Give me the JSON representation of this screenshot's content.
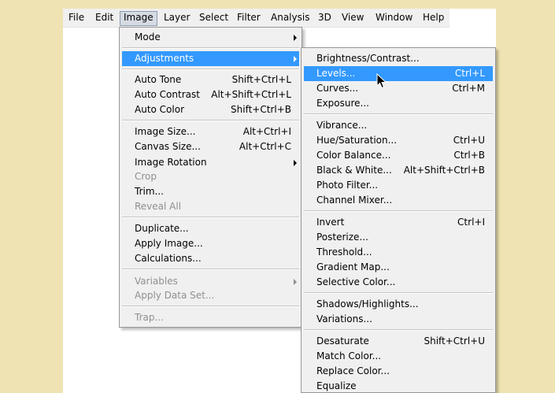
{
  "menubar": {
    "items": [
      "File",
      "Edit",
      "Image",
      "Layer",
      "Select",
      "Filter",
      "Analysis",
      "3D",
      "View",
      "Window",
      "Help"
    ],
    "active": "Image"
  },
  "image_menu": {
    "items": [
      {
        "label": "Mode",
        "shortcut": "",
        "submenu": true,
        "disabled": false
      },
      {
        "label": "Adjustments",
        "shortcut": "",
        "submenu": true,
        "disabled": false,
        "highlighted": true
      },
      {
        "label": "Auto Tone",
        "shortcut": "Shift+Ctrl+L",
        "disabled": false
      },
      {
        "label": "Auto Contrast",
        "shortcut": "Alt+Shift+Ctrl+L",
        "disabled": false
      },
      {
        "label": "Auto Color",
        "shortcut": "Shift+Ctrl+B",
        "disabled": false
      },
      {
        "label": "Image Size...",
        "shortcut": "Alt+Ctrl+I",
        "disabled": false
      },
      {
        "label": "Canvas Size...",
        "shortcut": "Alt+Ctrl+C",
        "disabled": false
      },
      {
        "label": "Image Rotation",
        "shortcut": "",
        "submenu": true,
        "disabled": false
      },
      {
        "label": "Crop",
        "shortcut": "",
        "disabled": true
      },
      {
        "label": "Trim...",
        "shortcut": "",
        "disabled": false
      },
      {
        "label": "Reveal All",
        "shortcut": "",
        "disabled": true
      },
      {
        "label": "Duplicate...",
        "shortcut": "",
        "disabled": false
      },
      {
        "label": "Apply Image...",
        "shortcut": "",
        "disabled": false
      },
      {
        "label": "Calculations...",
        "shortcut": "",
        "disabled": false
      },
      {
        "label": "Variables",
        "shortcut": "",
        "submenu": true,
        "disabled": true
      },
      {
        "label": "Apply Data Set...",
        "shortcut": "",
        "disabled": true
      },
      {
        "label": "Trap...",
        "shortcut": "",
        "disabled": true
      }
    ]
  },
  "adjustments_menu": {
    "items": [
      {
        "label": "Brightness/Contrast...",
        "shortcut": ""
      },
      {
        "label": "Levels...",
        "shortcut": "Ctrl+L",
        "highlighted": true
      },
      {
        "label": "Curves...",
        "shortcut": "Ctrl+M"
      },
      {
        "label": "Exposure...",
        "shortcut": ""
      },
      {
        "label": "Vibrance...",
        "shortcut": ""
      },
      {
        "label": "Hue/Saturation...",
        "shortcut": "Ctrl+U"
      },
      {
        "label": "Color Balance...",
        "shortcut": "Ctrl+B"
      },
      {
        "label": "Black & White...",
        "shortcut": "Alt+Shift+Ctrl+B"
      },
      {
        "label": "Photo Filter...",
        "shortcut": ""
      },
      {
        "label": "Channel Mixer...",
        "shortcut": ""
      },
      {
        "label": "Invert",
        "shortcut": "Ctrl+I"
      },
      {
        "label": "Posterize...",
        "shortcut": ""
      },
      {
        "label": "Threshold...",
        "shortcut": ""
      },
      {
        "label": "Gradient Map...",
        "shortcut": ""
      },
      {
        "label": "Selective Color...",
        "shortcut": ""
      },
      {
        "label": "Shadows/Highlights...",
        "shortcut": ""
      },
      {
        "label": "Variations...",
        "shortcut": ""
      },
      {
        "label": "Desaturate",
        "shortcut": "Shift+Ctrl+U"
      },
      {
        "label": "Match Color...",
        "shortcut": ""
      },
      {
        "label": "Replace Color...",
        "shortcut": ""
      },
      {
        "label": "Equalize",
        "shortcut": ""
      }
    ]
  },
  "colors": {
    "background": "#f0e3b3",
    "menu_bg": "#f0f0f0",
    "highlight": "#3399ff",
    "disabled_text": "#8f8f8f"
  },
  "cursor": "arrow-cursor-icon"
}
